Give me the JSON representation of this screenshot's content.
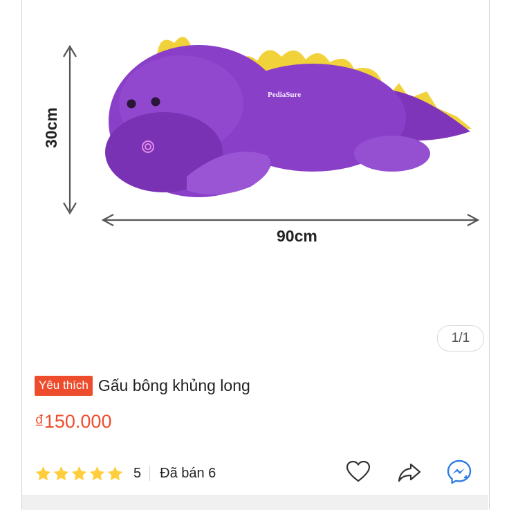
{
  "product": {
    "badge": "Yêu thích",
    "title": "Gấu bông khủng long",
    "price": "₫150.000",
    "brand_on_toy": "PediaSure"
  },
  "image": {
    "height_label": "30cm",
    "width_label": "90cm",
    "page_indicator": "1/1"
  },
  "rating": {
    "stars_filled": 5,
    "value": "5",
    "sold": "Đã bán 6"
  },
  "actions": {
    "favorite_icon": "heart-icon",
    "share_icon": "share-icon",
    "chat_icon": "messenger-icon"
  },
  "colors": {
    "accent": "#ee4d2d",
    "star": "#ffce3d",
    "toy_purple": "#8a3fc8",
    "toy_spikes": "#f2d23a",
    "messenger": "#2f7de1"
  }
}
